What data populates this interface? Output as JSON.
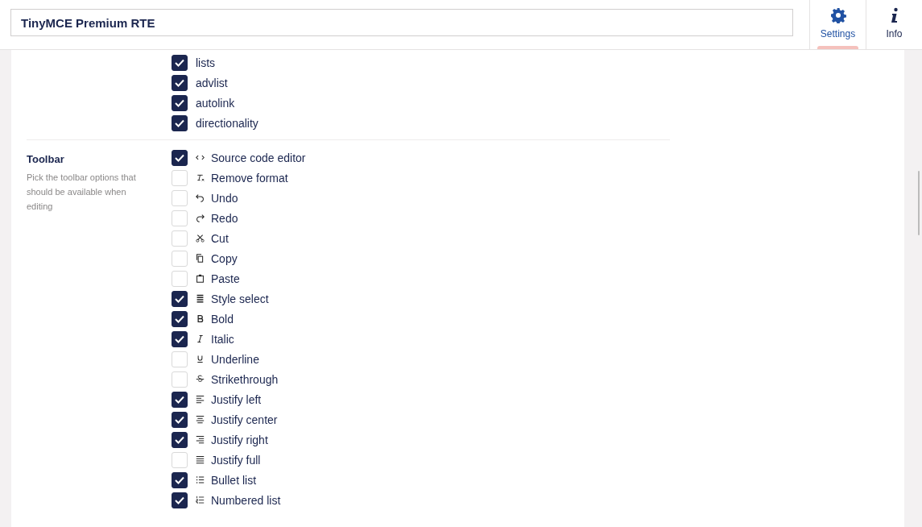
{
  "header": {
    "name_value": "TinyMCE Premium RTE",
    "tabs": [
      {
        "label": "Settings",
        "kind": "gear",
        "selected": true
      },
      {
        "label": "Info",
        "kind": "info",
        "selected": false
      }
    ]
  },
  "plugins": [
    {
      "label": "lists",
      "checked": true
    },
    {
      "label": "advlist",
      "checked": true
    },
    {
      "label": "autolink",
      "checked": true
    },
    {
      "label": "directionality",
      "checked": true
    }
  ],
  "toolbar": {
    "title": "Toolbar",
    "description": "Pick the toolbar options that should be available when editing",
    "options": [
      {
        "label": "Source code editor",
        "kind": "code",
        "checked": true
      },
      {
        "label": "Remove format",
        "kind": "removeformat",
        "checked": false
      },
      {
        "label": "Undo",
        "kind": "undo",
        "checked": false
      },
      {
        "label": "Redo",
        "kind": "redo",
        "checked": false
      },
      {
        "label": "Cut",
        "kind": "cut",
        "checked": false
      },
      {
        "label": "Copy",
        "kind": "copy",
        "checked": false
      },
      {
        "label": "Paste",
        "kind": "paste",
        "checked": false
      },
      {
        "label": "Style select",
        "kind": "styles",
        "checked": true
      },
      {
        "label": "Bold",
        "kind": "bold",
        "checked": true
      },
      {
        "label": "Italic",
        "kind": "italic",
        "checked": true
      },
      {
        "label": "Underline",
        "kind": "underline",
        "checked": false
      },
      {
        "label": "Strikethrough",
        "kind": "strike",
        "checked": false
      },
      {
        "label": "Justify left",
        "kind": "left",
        "checked": true
      },
      {
        "label": "Justify center",
        "kind": "center",
        "checked": true
      },
      {
        "label": "Justify right",
        "kind": "right",
        "checked": true
      },
      {
        "label": "Justify full",
        "kind": "full",
        "checked": false
      },
      {
        "label": "Bullet list",
        "kind": "bullets",
        "checked": true
      },
      {
        "label": "Numbered list",
        "kind": "numbers",
        "checked": true
      }
    ]
  }
}
